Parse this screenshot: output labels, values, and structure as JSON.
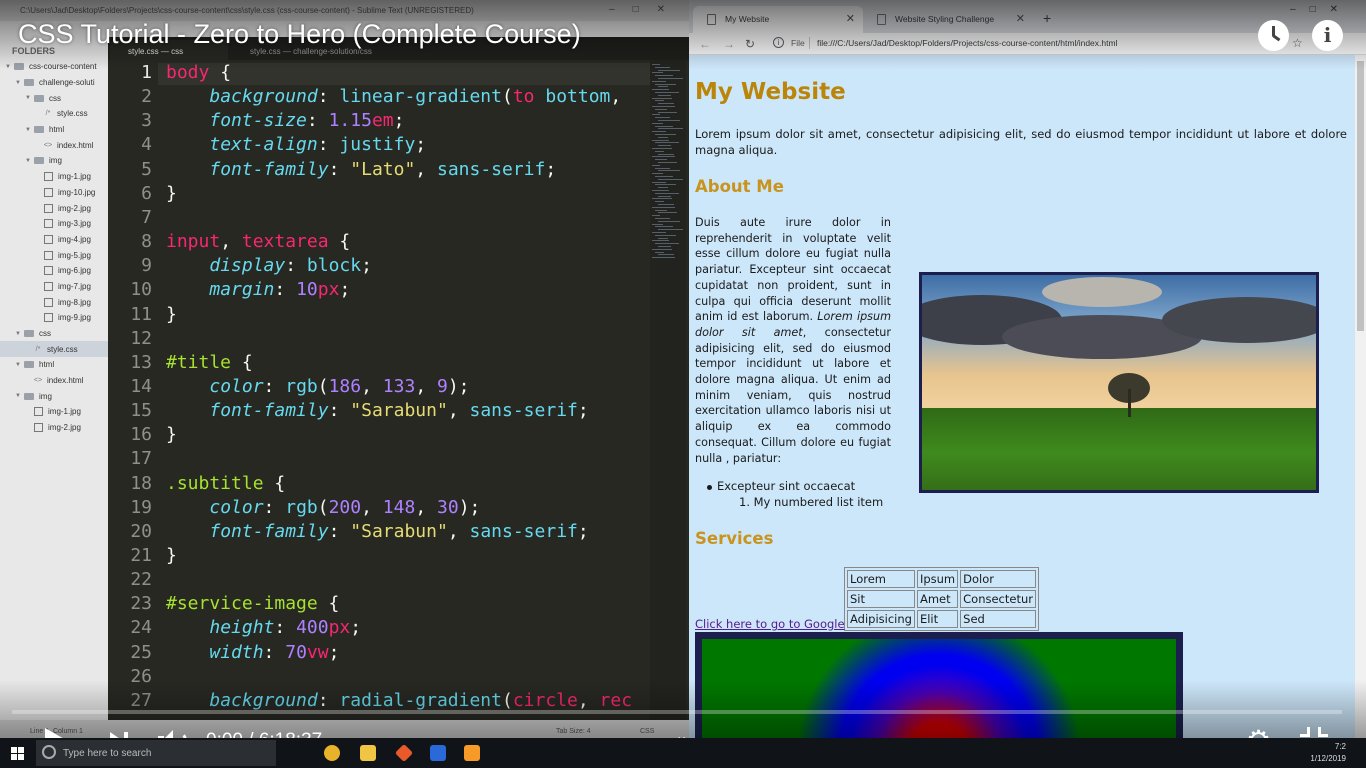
{
  "sublime": {
    "titlebar": "C:\\Users\\Jad\\Desktop\\Folders\\Projects\\css-course-content\\css\\style.css (css-course-content) - Sublime Text (UNREGISTERED)",
    "sidebar_header": "FOLDERS",
    "tree": [
      {
        "label": "css-course-content",
        "kind": "folder",
        "depth": 0
      },
      {
        "label": "challenge-soluti",
        "kind": "folder",
        "depth": 1
      },
      {
        "label": "css",
        "kind": "folder",
        "depth": 2
      },
      {
        "label": "style.css",
        "kind": "file",
        "depth": 3
      },
      {
        "label": "html",
        "kind": "folder",
        "depth": 2
      },
      {
        "label": "index.html",
        "kind": "file",
        "depth": 3
      },
      {
        "label": "img",
        "kind": "folder",
        "depth": 2
      },
      {
        "label": "img-1.jpg",
        "kind": "image",
        "depth": 3
      },
      {
        "label": "img-10.jpg",
        "kind": "image",
        "depth": 3
      },
      {
        "label": "img-2.jpg",
        "kind": "image",
        "depth": 3
      },
      {
        "label": "img-3.jpg",
        "kind": "image",
        "depth": 3
      },
      {
        "label": "img-4.jpg",
        "kind": "image",
        "depth": 3
      },
      {
        "label": "img-5.jpg",
        "kind": "image",
        "depth": 3
      },
      {
        "label": "img-6.jpg",
        "kind": "image",
        "depth": 3
      },
      {
        "label": "img-7.jpg",
        "kind": "image",
        "depth": 3
      },
      {
        "label": "img-8.jpg",
        "kind": "image",
        "depth": 3
      },
      {
        "label": "img-9.jpg",
        "kind": "image",
        "depth": 3
      },
      {
        "label": "css",
        "kind": "folder",
        "depth": 1
      },
      {
        "label": "style.css",
        "kind": "file",
        "depth": 2,
        "selected": true
      },
      {
        "label": "html",
        "kind": "folder",
        "depth": 1
      },
      {
        "label": "index.html",
        "kind": "file",
        "depth": 2
      },
      {
        "label": "img",
        "kind": "folder",
        "depth": 1
      },
      {
        "label": "img-1.jpg",
        "kind": "image",
        "depth": 2
      },
      {
        "label": "img-2.jpg",
        "kind": "image",
        "depth": 2
      }
    ],
    "tabs": [
      {
        "label": "style.css — css",
        "active": true
      },
      {
        "label": "style.css — challenge-solution/css",
        "active": false
      }
    ],
    "current_line": 1,
    "code_lines": [
      [
        [
          "sel",
          "body"
        ],
        [
          "pun",
          " {"
        ]
      ],
      [
        [
          "pun",
          "    "
        ],
        [
          "prop",
          "background"
        ],
        [
          "pun",
          ": "
        ],
        [
          "val",
          "linear-gradient"
        ],
        [
          "pun",
          "("
        ],
        [
          "kw",
          "to"
        ],
        [
          "pun",
          " "
        ],
        [
          "val",
          "bottom"
        ],
        [
          "pun",
          ","
        ]
      ],
      [
        [
          "pun",
          "    "
        ],
        [
          "prop",
          "font-size"
        ],
        [
          "pun",
          ": "
        ],
        [
          "num",
          "1.15"
        ],
        [
          "unit",
          "em"
        ],
        [
          "pun",
          ";"
        ]
      ],
      [
        [
          "pun",
          "    "
        ],
        [
          "prop",
          "text-align"
        ],
        [
          "pun",
          ": "
        ],
        [
          "val",
          "justify"
        ],
        [
          "pun",
          ";"
        ]
      ],
      [
        [
          "pun",
          "    "
        ],
        [
          "prop",
          "font-family"
        ],
        [
          "pun",
          ": "
        ],
        [
          "str",
          "\"Lato\""
        ],
        [
          "pun",
          ", "
        ],
        [
          "val",
          "sans-serif"
        ],
        [
          "pun",
          ";"
        ]
      ],
      [
        [
          "pun",
          "}"
        ]
      ],
      [
        [
          "pun",
          ""
        ]
      ],
      [
        [
          "sel",
          "input"
        ],
        [
          "pun",
          ", "
        ],
        [
          "sel",
          "textarea"
        ],
        [
          "pun",
          " {"
        ]
      ],
      [
        [
          "pun",
          "    "
        ],
        [
          "prop",
          "display"
        ],
        [
          "pun",
          ": "
        ],
        [
          "val",
          "block"
        ],
        [
          "pun",
          ";"
        ]
      ],
      [
        [
          "pun",
          "    "
        ],
        [
          "prop",
          "margin"
        ],
        [
          "pun",
          ": "
        ],
        [
          "num",
          "10"
        ],
        [
          "unit",
          "px"
        ],
        [
          "pun",
          ";"
        ]
      ],
      [
        [
          "pun",
          "}"
        ]
      ],
      [
        [
          "pun",
          ""
        ]
      ],
      [
        [
          "idsel",
          "#title"
        ],
        [
          "pun",
          " {"
        ]
      ],
      [
        [
          "pun",
          "    "
        ],
        [
          "prop",
          "color"
        ],
        [
          "pun",
          ": "
        ],
        [
          "val",
          "rgb"
        ],
        [
          "pun",
          "("
        ],
        [
          "num",
          "186"
        ],
        [
          "pun",
          ", "
        ],
        [
          "num",
          "133"
        ],
        [
          "pun",
          ", "
        ],
        [
          "num",
          "9"
        ],
        [
          "pun",
          ");"
        ]
      ],
      [
        [
          "pun",
          "    "
        ],
        [
          "prop",
          "font-family"
        ],
        [
          "pun",
          ": "
        ],
        [
          "str",
          "\"Sarabun\""
        ],
        [
          "pun",
          ", "
        ],
        [
          "val",
          "sans-serif"
        ],
        [
          "pun",
          ";"
        ]
      ],
      [
        [
          "pun",
          "}"
        ]
      ],
      [
        [
          "pun",
          ""
        ]
      ],
      [
        [
          "idsel",
          ".subtitle"
        ],
        [
          "pun",
          " {"
        ]
      ],
      [
        [
          "pun",
          "    "
        ],
        [
          "prop",
          "color"
        ],
        [
          "pun",
          ": "
        ],
        [
          "val",
          "rgb"
        ],
        [
          "pun",
          "("
        ],
        [
          "num",
          "200"
        ],
        [
          "pun",
          ", "
        ],
        [
          "num",
          "148"
        ],
        [
          "pun",
          ", "
        ],
        [
          "num",
          "30"
        ],
        [
          "pun",
          ");"
        ]
      ],
      [
        [
          "pun",
          "    "
        ],
        [
          "prop",
          "font-family"
        ],
        [
          "pun",
          ": "
        ],
        [
          "str",
          "\"Sarabun\""
        ],
        [
          "pun",
          ", "
        ],
        [
          "val",
          "sans-serif"
        ],
        [
          "pun",
          ";"
        ]
      ],
      [
        [
          "pun",
          "}"
        ]
      ],
      [
        [
          "pun",
          ""
        ]
      ],
      [
        [
          "idsel",
          "#service-image"
        ],
        [
          "pun",
          " {"
        ]
      ],
      [
        [
          "pun",
          "    "
        ],
        [
          "prop",
          "height"
        ],
        [
          "pun",
          ": "
        ],
        [
          "num",
          "400"
        ],
        [
          "unit",
          "px"
        ],
        [
          "pun",
          ";"
        ]
      ],
      [
        [
          "pun",
          "    "
        ],
        [
          "prop",
          "width"
        ],
        [
          "pun",
          ": "
        ],
        [
          "num",
          "70"
        ],
        [
          "unit",
          "vw"
        ],
        [
          "pun",
          ";"
        ]
      ],
      [
        [
          "pun",
          ""
        ]
      ],
      [
        [
          "pun",
          "    "
        ],
        [
          "prop",
          "background"
        ],
        [
          "pun",
          ": "
        ],
        [
          "val",
          "radial-gradient"
        ],
        [
          "pun",
          "("
        ],
        [
          "kw",
          "circle"
        ],
        [
          "pun",
          ", "
        ],
        [
          "kw",
          "rec"
        ]
      ]
    ],
    "status_left": "Line 1, Column 1",
    "status_tabsize": "Tab Size: 4",
    "status_syntax": "CSS"
  },
  "chrome": {
    "tabs": [
      {
        "label": "My Website",
        "active": true
      },
      {
        "label": "Website Styling Challenge",
        "active": false
      }
    ],
    "file_label": "File",
    "url": "file:///C:/Users/Jad/Desktop/Folders/Projects/css-course-content/html/index.html",
    "page": {
      "title": "My Website",
      "intro": "Lorem ipsum dolor sit amet, consectetur adipisicing elit, sed do eiusmod tempor incididunt ut labore et dolore magna aliqua.",
      "about_heading": "About Me",
      "about_text": "Duis aute irure dolor in reprehenderit in voluptate velit esse cillum dolore eu fugiat nulla pariatur. Excepteur sint occaecat cupidatat non proident, sunt in culpa qui officia deserunt mollit anim id est laborum.",
      "about_italic": "Lorem ipsum dolor sit amet",
      "about_text2": ", consectetur adipisicing elit, sed do eiusmod tempor incididunt ut labore et dolore magna aliqua. Ut enim ad minim veniam, quis nostrud exercitation ullamco laboris nisi ut aliquip ex ea commodo consequat. Cillum dolore eu fugiat nulla , pariatur:",
      "bullet_item": "Excepteur sint occaecat",
      "ol_item": "1. My numbered list item",
      "services_heading": "Services",
      "table": [
        [
          "Lorem",
          "Ipsum",
          "Dolor"
        ],
        [
          "Sit",
          "Amet",
          "Consectetur"
        ],
        [
          "Adipisicing",
          "Elit",
          "Sed"
        ]
      ],
      "link_text": "Click here to go to Google"
    }
  },
  "youtube": {
    "title": "CSS Tutorial - Zero to Hero (Complete Course)",
    "time": "0:00 / 6:18:37",
    "progress": 0.0
  },
  "taskbar": {
    "search_placeholder": "Type here to search",
    "time": "7:2",
    "date": "1/12/2019"
  },
  "colors": {
    "title_color": "#ba8509",
    "subtitle_color": "#c8941e",
    "page_bg": "#cde7fa"
  }
}
